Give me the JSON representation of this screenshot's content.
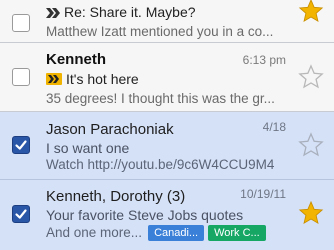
{
  "colors": {
    "accent": "#2a56a8",
    "selected_row": "#d5e1f7",
    "star_on": "#f3b400",
    "importance_marker": "#f0b400"
  },
  "messages": [
    {
      "sender": "",
      "time": "",
      "subject": "Re: Share it. Maybe?",
      "snippet": "Matthew Izatt mentioned you in a co...",
      "checked": false,
      "starred": true,
      "important": true,
      "unread": false,
      "labels": []
    },
    {
      "sender": "Kenneth",
      "time": "6:13 pm",
      "subject": "It's hot here",
      "snippet": "35 degrees! I thought this was the gr...",
      "checked": false,
      "starred": false,
      "important": true,
      "unread": true,
      "labels": []
    },
    {
      "sender": "Jason Parachoniak",
      "time": "4/18",
      "subject": "I so want one",
      "snippet": "Watch http://youtu.be/9c6W4CCU9M4",
      "checked": true,
      "starred": false,
      "important": false,
      "unread": false,
      "labels": []
    },
    {
      "sender": "Kenneth, Dorothy (3)",
      "time": "10/19/11",
      "subject": "Your favorite Steve Jobs quotes",
      "snippet": "And one more...",
      "checked": true,
      "starred": true,
      "important": false,
      "unread": false,
      "labels": [
        {
          "text": "Canadi...",
          "color": "#3a7fd8"
        },
        {
          "text": "Work C...",
          "color": "#16a765"
        }
      ]
    }
  ]
}
